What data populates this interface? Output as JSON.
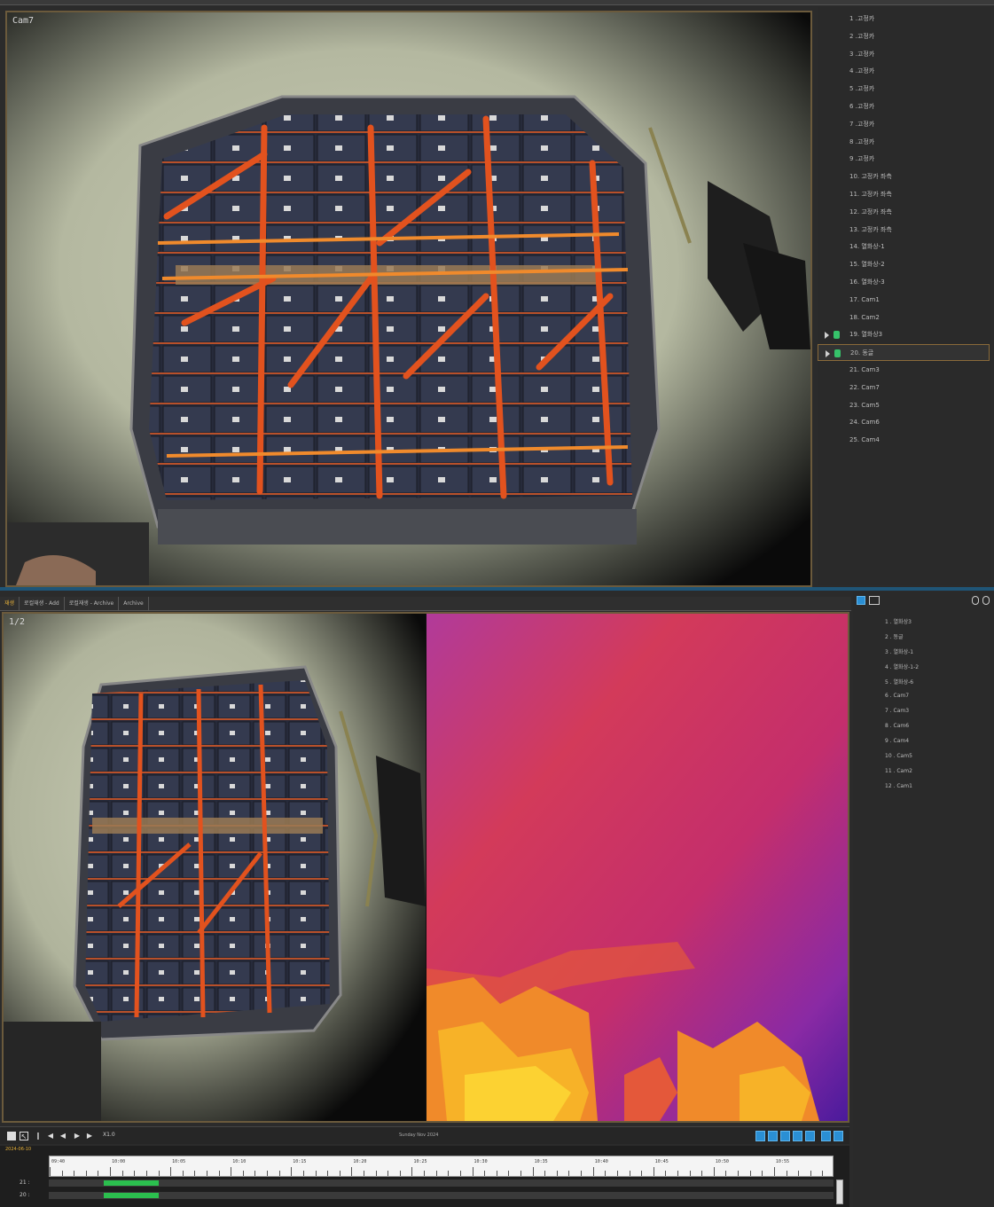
{
  "top_window": {
    "video_label": "Cam7",
    "camera_list": [
      {
        "label": "1 .고정카"
      },
      {
        "label": "2 .고정카"
      },
      {
        "label": "3 .고정카"
      },
      {
        "label": "4 .고정카"
      },
      {
        "label": "5 .고정카"
      },
      {
        "label": "6 .고정카"
      },
      {
        "label": "7 .고정카"
      },
      {
        "label": "8 .고정카"
      },
      {
        "label": "9 .고정카"
      },
      {
        "label": "10. 고정카 좌측"
      },
      {
        "label": "11. 고정카 좌측"
      },
      {
        "label": "12. 고정카 좌측"
      },
      {
        "label": "13. 고정카 좌측"
      },
      {
        "label": "14. 열화상-1"
      },
      {
        "label": "15. 열화상-2"
      },
      {
        "label": "16. 열화상-3"
      },
      {
        "label": "17. Cam1"
      },
      {
        "label": "18. Cam2"
      },
      {
        "label": "19. 열화상3",
        "live": true
      },
      {
        "label": "20. 동글",
        "live": true,
        "selected": true
      },
      {
        "label": "21. Cam3"
      },
      {
        "label": "22. Cam7"
      },
      {
        "label": "23. Cam5"
      },
      {
        "label": "24. Cam6"
      },
      {
        "label": "25. Cam4"
      }
    ]
  },
  "bottom_window": {
    "tabs": [
      {
        "label": "재생",
        "active": true
      },
      {
        "label": "로컬재생 - Add"
      },
      {
        "label": "로컬재생 - Archive"
      },
      {
        "label": "Archive"
      }
    ],
    "video_label": "1/2",
    "camera_list": [
      {
        "label": "1 . 열화상3"
      },
      {
        "label": "2 . 동글"
      },
      {
        "label": "3 . 열화상-1"
      },
      {
        "label": "4 . 열화상-1-2"
      },
      {
        "label": "5 . 열화상-6"
      },
      {
        "label": "6 . Cam7"
      },
      {
        "label": "7 . Cam3"
      },
      {
        "label": "8 . Cam6"
      },
      {
        "label": "9 . Cam4"
      },
      {
        "label": "10 . Cam5"
      },
      {
        "label": "11 . Cam2"
      },
      {
        "label": "12 . Cam1"
      }
    ],
    "playback": {
      "speed_label": "X1.0",
      "center_label": "Sunday Nov 2024",
      "date_label": "2024-06-10"
    },
    "timeline": {
      "labels": [
        "09:40",
        "10:00",
        "10:05",
        "10:10",
        "10:15",
        "10:20",
        "10:25",
        "10:30",
        "10:35",
        "10:40",
        "10:45",
        "10:50",
        "10:55"
      ],
      "rows": [
        {
          "label": "21 :",
          "coverage": [
            0.07,
            0.14
          ]
        },
        {
          "label": "20 :",
          "coverage": [
            0.07,
            0.14
          ]
        }
      ]
    }
  },
  "colors": {
    "accent_blue": "#2a8fd4",
    "frame_border": "#6b5a3c",
    "live_green": "#36c26a",
    "track_green": "#2bbf4e"
  }
}
